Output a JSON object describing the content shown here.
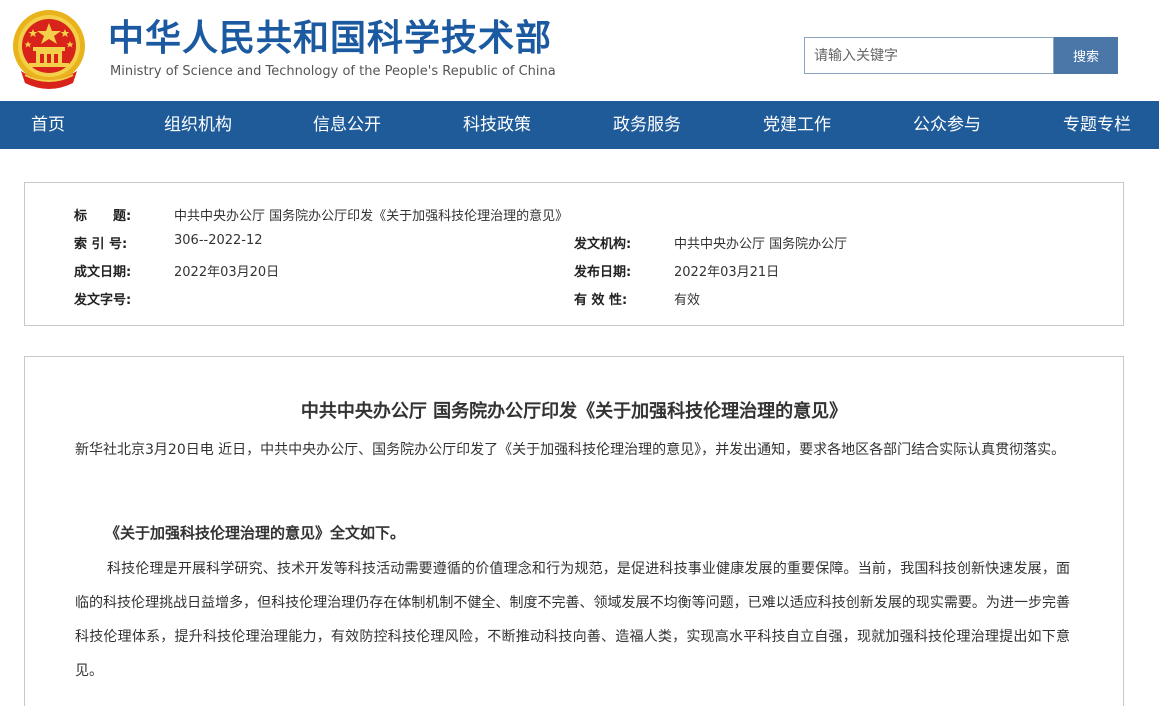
{
  "header": {
    "title": "中华人民共和国科学技术部",
    "subtitle": "Ministry of Science and Technology of the People's Republic of China",
    "emblem_icon": "national-emblem-icon"
  },
  "search": {
    "placeholder": "请输入关键字",
    "button_label": "搜索"
  },
  "nav": {
    "items": [
      {
        "label": "首页"
      },
      {
        "label": "组织机构"
      },
      {
        "label": "信息公开"
      },
      {
        "label": "科技政策"
      },
      {
        "label": "政务服务"
      },
      {
        "label": "党建工作"
      },
      {
        "label": "公众参与"
      },
      {
        "label": "专题专栏"
      }
    ]
  },
  "info": {
    "title_label": "标　　题:",
    "title_value": "中共中央办公厅 国务院办公厅印发《关于加强科技伦理治理的意见》",
    "index_label": "索 引 号:",
    "index_value": "306--2022-12",
    "issuer_label": "发文机构:",
    "issuer_value": "中共中央办公厅 国务院办公厅",
    "created_label": "成文日期:",
    "created_value": "2022年03月20日",
    "published_label": "发布日期:",
    "published_value": "2022年03月21日",
    "docno_label": "发文字号:",
    "docno_value": "",
    "validity_label": "有 效 性:",
    "validity_value": "有效"
  },
  "article": {
    "title": "中共中央办公厅 国务院办公厅印发《关于加强科技伦理治理的意见》",
    "lead": "新华社北京3月20日电 近日，中共中央办公厅、国务院办公厅印发了《关于加强科技伦理治理的意见》，并发出通知，要求各地区各部门结合实际认真贯彻落实。",
    "subhead": "《关于加强科技伦理治理的意见》全文如下。",
    "body": "科技伦理是开展科学研究、技术开发等科技活动需要遵循的价值理念和行为规范，是促进科技事业健康发展的重要保障。当前，我国科技创新快速发展，面临的科技伦理挑战日益增多，但科技伦理治理仍存在体制机制不健全、制度不完善、领域发展不均衡等问题，已难以适应科技创新发展的现实需要。为进一步完善科技伦理体系，提升科技伦理治理能力，有效防控科技伦理风险，不断推动科技向善、造福人类，实现高水平科技自立自强，现就加强科技伦理治理提出如下意见。"
  },
  "colors": {
    "brand_blue": "#1b5aa0",
    "nav_bg": "#1f5b99",
    "search_button": "#4a76a8",
    "emblem_red": "#d8231a",
    "emblem_gold": "#f2c21a"
  }
}
